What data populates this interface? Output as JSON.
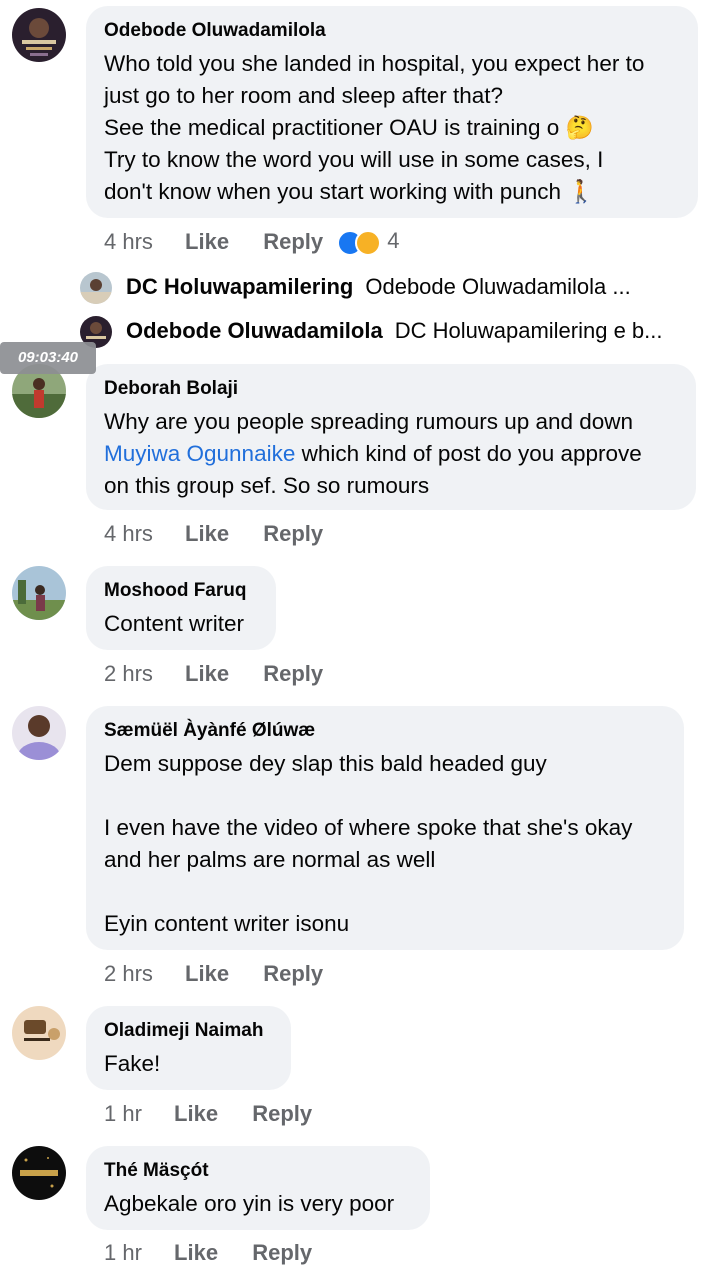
{
  "comments": [
    {
      "author": "Odebode Oluwadamilola",
      "lines": [
        "Who told you she landed in hospital, you expect her to",
        "just go to her room and sleep after that?",
        "See the medical practitioner OAU is training o 🤔",
        "Try to know the word you will use in some cases, I",
        "don't know when you start working with punch 🚶"
      ],
      "time": "4 hrs",
      "like": "Like",
      "reply": "Reply",
      "reaction_count": "4"
    },
    {
      "author": "Deborah Bolaji",
      "line1": "Why are you people spreading rumours up and down",
      "mention": "Muyiwa Ogunnaike",
      "line2_rest": " which kind of post do you approve",
      "line3": "on this group sef. So so rumours",
      "time": "4 hrs",
      "like": "Like",
      "reply": "Reply"
    },
    {
      "author": "Moshood Faruq",
      "lines": [
        "Content writer"
      ],
      "time": "2 hrs",
      "like": "Like",
      "reply": "Reply"
    },
    {
      "author": "Sæmüël Àyànfé Ølúwæ",
      "lines": [
        "Dem suppose dey slap this bald headed guy",
        "",
        "I even have the video of where spoke that she's okay",
        "and her palms are normal as well",
        "",
        "Eyin content writer isonu"
      ],
      "time": "2 hrs",
      "like": "Like",
      "reply": "Reply"
    },
    {
      "author": "Oladimeji Naimah",
      "lines": [
        "Fake!"
      ],
      "time": "1 hr",
      "like": "Like",
      "reply": "Reply"
    },
    {
      "author": "Thé Mäsçót",
      "lines": [
        "Agbekale oro yin is very poor"
      ],
      "time": "1 hr",
      "like": "Like",
      "reply": "Reply"
    }
  ],
  "replies": [
    {
      "author": "DC Holuwapamilering",
      "snippet": "Odebode Oluwadamilola ..."
    },
    {
      "author": "Odebode Oluwadamilola",
      "snippet": "DC Holuwapamilering e b..."
    }
  ],
  "video_timestamp": "09:03:40",
  "colors": {
    "bubble": "#f0f2f5",
    "mention": "#216fdb",
    "meta_text": "#65676b",
    "like_reaction": "#1877f2",
    "haha_reaction": "#f7b125"
  }
}
